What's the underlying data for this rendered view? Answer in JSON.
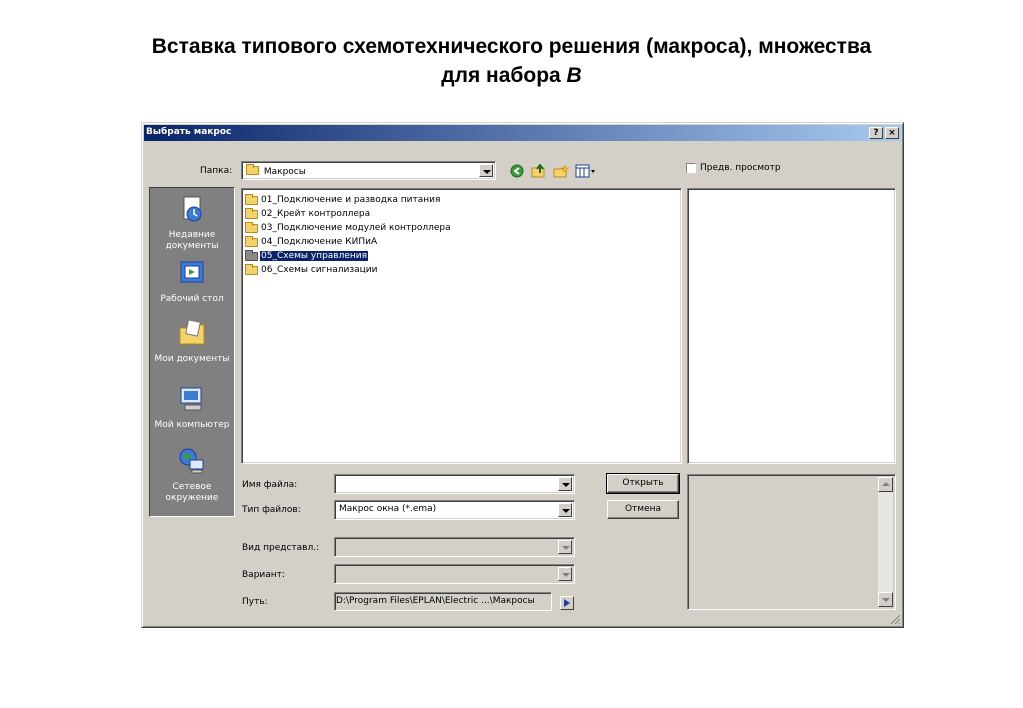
{
  "slide": {
    "title_line1": "Вставка типового схемотехнического решения (макроса), множества",
    "title_line2_prefix": "для набора ",
    "title_line2_var": "B"
  },
  "dialog": {
    "title": "Выбрать макрос",
    "help_btn": "?",
    "close_btn": "×",
    "folder_label": "Папка:",
    "folder_value": "Макросы",
    "preview_label": "Предв. просмотр",
    "places": [
      {
        "label": "Недавние документы",
        "icon": "recent-documents-icon"
      },
      {
        "label": "Рабочий стол",
        "icon": "desktop-icon"
      },
      {
        "label": "Мои документы",
        "icon": "my-documents-icon"
      },
      {
        "label": "Мой компьютер",
        "icon": "my-computer-icon"
      },
      {
        "label": "Сетевое окружение",
        "icon": "network-icon"
      }
    ],
    "files": [
      {
        "name": "01_Подключение и разводка питания"
      },
      {
        "name": "02_Крейт контроллера"
      },
      {
        "name": "03_Подключение модулей контроллера"
      },
      {
        "name": "04_Подключение КИПиА"
      },
      {
        "name": "05_Схемы управления",
        "selected": true
      },
      {
        "name": "06_Схемы сигнализации"
      }
    ],
    "filename_label": "Имя файла:",
    "filename_value": "",
    "filetype_label": "Тип файлов:",
    "filetype_value": "Макрос окна (*.ema)",
    "view_label": "Вид представл.:",
    "view_value": "",
    "variant_label": "Вариант:",
    "variant_value": "",
    "path_label": "Путь:",
    "path_value": "D:\\Program Files\\EPLAN\\Electric ...\\Макросы",
    "open_btn": "Открыть",
    "cancel_btn": "Отмена"
  },
  "colors": {
    "dialog_bg": "#d4d0c8",
    "title_bar": "#0a246a",
    "selection": "#0a246a"
  }
}
